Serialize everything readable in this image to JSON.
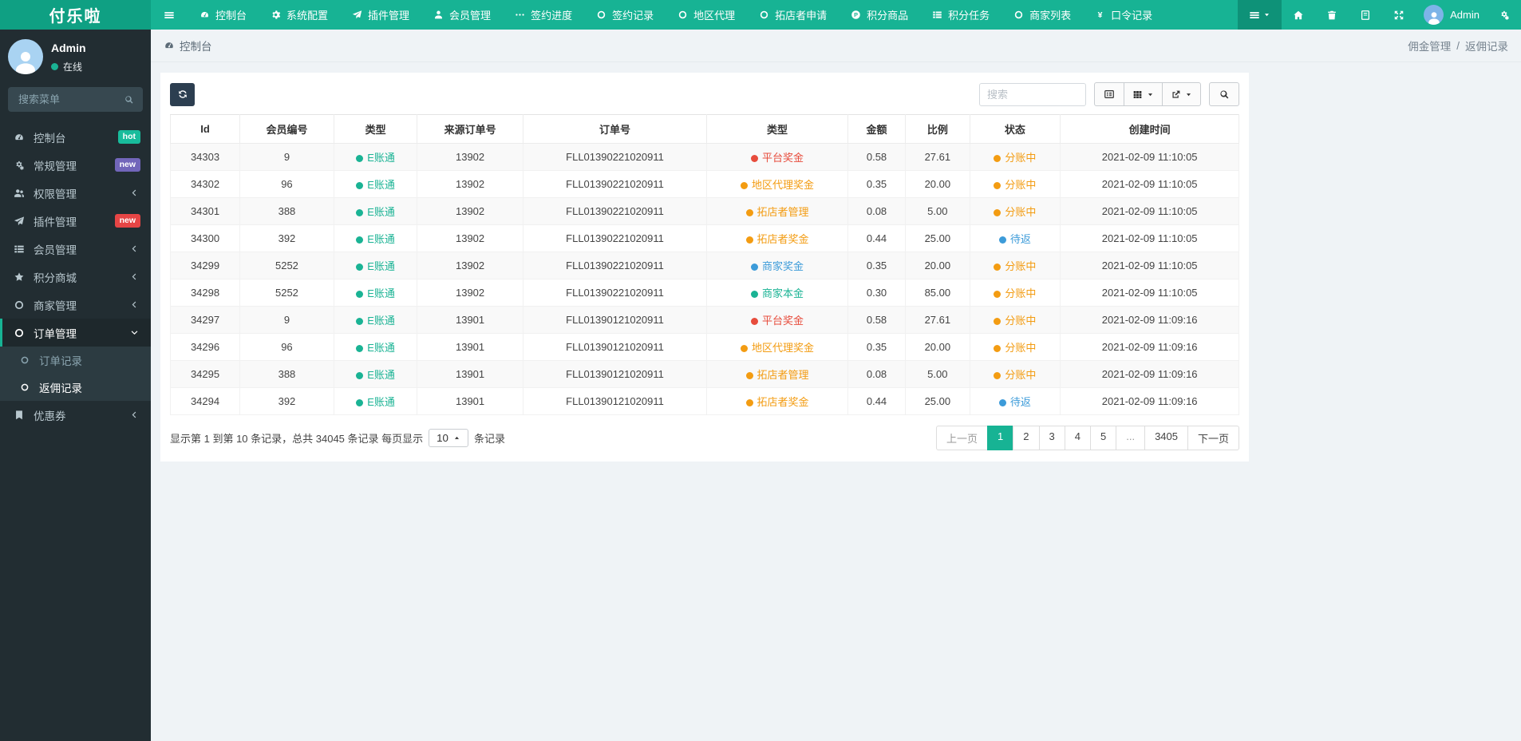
{
  "colors": {
    "navbar": "#17b394",
    "brand_bg": "#0fa083",
    "sidebar_bg": "#222d32",
    "accent": "#17b394",
    "badge_hot": "#18bc9c",
    "badge_new_purple": "#7266ba",
    "badge_new_red": "#e64545",
    "type_green": "#1ab394",
    "type_red": "#e74c3c",
    "type_orange": "#f39c12",
    "type_blue": "#3c9bd9"
  },
  "navbar": {
    "brand": "付乐啦",
    "items": [
      {
        "name": "console",
        "icon": "gauge",
        "label": "控制台"
      },
      {
        "name": "system-config",
        "icon": "gear",
        "label": "系统配置"
      },
      {
        "name": "plugin-manage",
        "icon": "send",
        "label": "插件管理"
      },
      {
        "name": "member-manage",
        "icon": "user",
        "label": "会员管理"
      },
      {
        "name": "sign-progress",
        "icon": "ellipsis",
        "label": "签约进度"
      },
      {
        "name": "sign-records",
        "icon": "circle",
        "label": "签约记录"
      },
      {
        "name": "area-agent",
        "icon": "circle",
        "label": "地区代理"
      },
      {
        "name": "shop-developer-apply",
        "icon": "circle",
        "label": "拓店者申请"
      },
      {
        "name": "points-goods",
        "icon": "p-circle",
        "label": "积分商品"
      },
      {
        "name": "points-tasks",
        "icon": "list",
        "label": "积分任务"
      },
      {
        "name": "merchant-list",
        "icon": "circle",
        "label": "商家列表"
      },
      {
        "name": "password-records",
        "icon": "yen",
        "label": "口令记录"
      }
    ],
    "right_buttons": [
      {
        "name": "tabs-dropdown-button",
        "icon": "menu",
        "caret": true,
        "active": true
      },
      {
        "name": "home-button",
        "icon": "home"
      },
      {
        "name": "clear-cache-button",
        "icon": "trash"
      },
      {
        "name": "docs-button",
        "icon": "book"
      },
      {
        "name": "fullscreen-button",
        "icon": "expand"
      }
    ],
    "user": {
      "name": "Admin"
    }
  },
  "sidebar": {
    "user": {
      "name": "Admin",
      "status": "在线"
    },
    "search_placeholder": "搜索菜单",
    "menu": [
      {
        "name": "console",
        "icon": "gauge",
        "label": "控制台",
        "badge": "hot",
        "badge_color": "#18bc9c"
      },
      {
        "name": "general-manage",
        "icon": "gears",
        "label": "常规管理",
        "badge": "new",
        "badge_color": "#7266ba"
      },
      {
        "name": "permission-manage",
        "icon": "users",
        "label": "权限管理",
        "chevron": "left"
      },
      {
        "name": "plugin-manage",
        "icon": "send",
        "label": "插件管理",
        "badge": "new",
        "badge_color": "#e64545"
      },
      {
        "name": "member-manage",
        "icon": "list",
        "label": "会员管理",
        "chevron": "left"
      },
      {
        "name": "points-mall",
        "icon": "star",
        "label": "积分商城",
        "chevron": "left"
      },
      {
        "name": "merchant-manage",
        "icon": "circle",
        "label": "商家管理",
        "chevron": "left"
      },
      {
        "name": "order-manage",
        "icon": "circle",
        "label": "订单管理",
        "chevron": "down",
        "active": true,
        "children": [
          {
            "name": "order-records",
            "label": "订单记录"
          },
          {
            "name": "rebate-records",
            "label": "返佣记录",
            "current": true
          }
        ]
      },
      {
        "name": "coupons",
        "icon": "flag",
        "label": "优惠券",
        "chevron": "left"
      }
    ]
  },
  "breadcrumb": {
    "left": "控制台",
    "sep": "/",
    "right": [
      "佣金管理",
      "返佣记录"
    ]
  },
  "toolbar": {
    "search_placeholder": "搜索"
  },
  "table": {
    "headers": [
      "Id",
      "会员编号",
      "类型",
      "来源订单号",
      "订单号",
      "类型",
      "金额",
      "比例",
      "状态",
      "创建时间"
    ],
    "header_names": [
      "id",
      "member-no",
      "type",
      "source-order-no",
      "order-no",
      "bonus-type",
      "amount",
      "ratio",
      "status",
      "created-at"
    ],
    "col_widths": [
      "6.5%",
      "8.8%",
      "7.8%",
      "9.9%",
      "17.2%",
      "13.2%",
      "5.4%",
      "6.0%",
      "8.5%",
      "16.7%"
    ],
    "rows": [
      {
        "cells": [
          "34303",
          "9",
          {
            "label": "E账通",
            "color": "#1ab394"
          },
          "13902",
          "FLL01390221020911",
          {
            "label": "平台奖金",
            "color": "#e74c3c"
          },
          "0.58",
          "27.61",
          {
            "label": "分账中",
            "color": "#f39c12"
          },
          "2021-02-09 11:10:05"
        ]
      },
      {
        "cells": [
          "34302",
          "96",
          {
            "label": "E账通",
            "color": "#1ab394"
          },
          "13902",
          "FLL01390221020911",
          {
            "label": "地区代理奖金",
            "color": "#f39c12"
          },
          "0.35",
          "20.00",
          {
            "label": "分账中",
            "color": "#f39c12"
          },
          "2021-02-09 11:10:05"
        ]
      },
      {
        "cells": [
          "34301",
          "388",
          {
            "label": "E账通",
            "color": "#1ab394"
          },
          "13902",
          "FLL01390221020911",
          {
            "label": "拓店者管理",
            "color": "#f39c12"
          },
          "0.08",
          "5.00",
          {
            "label": "分账中",
            "color": "#f39c12"
          },
          "2021-02-09 11:10:05"
        ]
      },
      {
        "cells": [
          "34300",
          "392",
          {
            "label": "E账通",
            "color": "#1ab394"
          },
          "13902",
          "FLL01390221020911",
          {
            "label": "拓店者奖金",
            "color": "#f39c12"
          },
          "0.44",
          "25.00",
          {
            "label": "待返",
            "color": "#3c9bd9"
          },
          "2021-02-09 11:10:05"
        ]
      },
      {
        "cells": [
          "34299",
          "5252",
          {
            "label": "E账通",
            "color": "#1ab394"
          },
          "13902",
          "FLL01390221020911",
          {
            "label": "商家奖金",
            "color": "#3c9bd9"
          },
          "0.35",
          "20.00",
          {
            "label": "分账中",
            "color": "#f39c12"
          },
          "2021-02-09 11:10:05"
        ]
      },
      {
        "cells": [
          "34298",
          "5252",
          {
            "label": "E账通",
            "color": "#1ab394"
          },
          "13902",
          "FLL01390221020911",
          {
            "label": "商家本金",
            "color": "#1ab394"
          },
          "0.30",
          "85.00",
          {
            "label": "分账中",
            "color": "#f39c12"
          },
          "2021-02-09 11:10:05"
        ]
      },
      {
        "cells": [
          "34297",
          "9",
          {
            "label": "E账通",
            "color": "#1ab394"
          },
          "13901",
          "FLL01390121020911",
          {
            "label": "平台奖金",
            "color": "#e74c3c"
          },
          "0.58",
          "27.61",
          {
            "label": "分账中",
            "color": "#f39c12"
          },
          "2021-02-09 11:09:16"
        ]
      },
      {
        "cells": [
          "34296",
          "96",
          {
            "label": "E账通",
            "color": "#1ab394"
          },
          "13901",
          "FLL01390121020911",
          {
            "label": "地区代理奖金",
            "color": "#f39c12"
          },
          "0.35",
          "20.00",
          {
            "label": "分账中",
            "color": "#f39c12"
          },
          "2021-02-09 11:09:16"
        ]
      },
      {
        "cells": [
          "34295",
          "388",
          {
            "label": "E账通",
            "color": "#1ab394"
          },
          "13901",
          "FLL01390121020911",
          {
            "label": "拓店者管理",
            "color": "#f39c12"
          },
          "0.08",
          "5.00",
          {
            "label": "分账中",
            "color": "#f39c12"
          },
          "2021-02-09 11:09:16"
        ]
      },
      {
        "cells": [
          "34294",
          "392",
          {
            "label": "E账通",
            "color": "#1ab394"
          },
          "13901",
          "FLL01390121020911",
          {
            "label": "拓店者奖金",
            "color": "#f39c12"
          },
          "0.44",
          "25.00",
          {
            "label": "待返",
            "color": "#3c9bd9"
          },
          "2021-02-09 11:09:16"
        ]
      }
    ]
  },
  "pagination": {
    "info_prefix": "显示第 1 到第 10 条记录，总共 34045 条记录 每页显示",
    "page_size": "10",
    "info_suffix": "条记录",
    "pages": [
      "上一页",
      "1",
      "2",
      "3",
      "4",
      "5",
      "...",
      "3405",
      "下一页"
    ],
    "active_page": "1",
    "muted_pages": [
      "上一页",
      "..."
    ]
  }
}
